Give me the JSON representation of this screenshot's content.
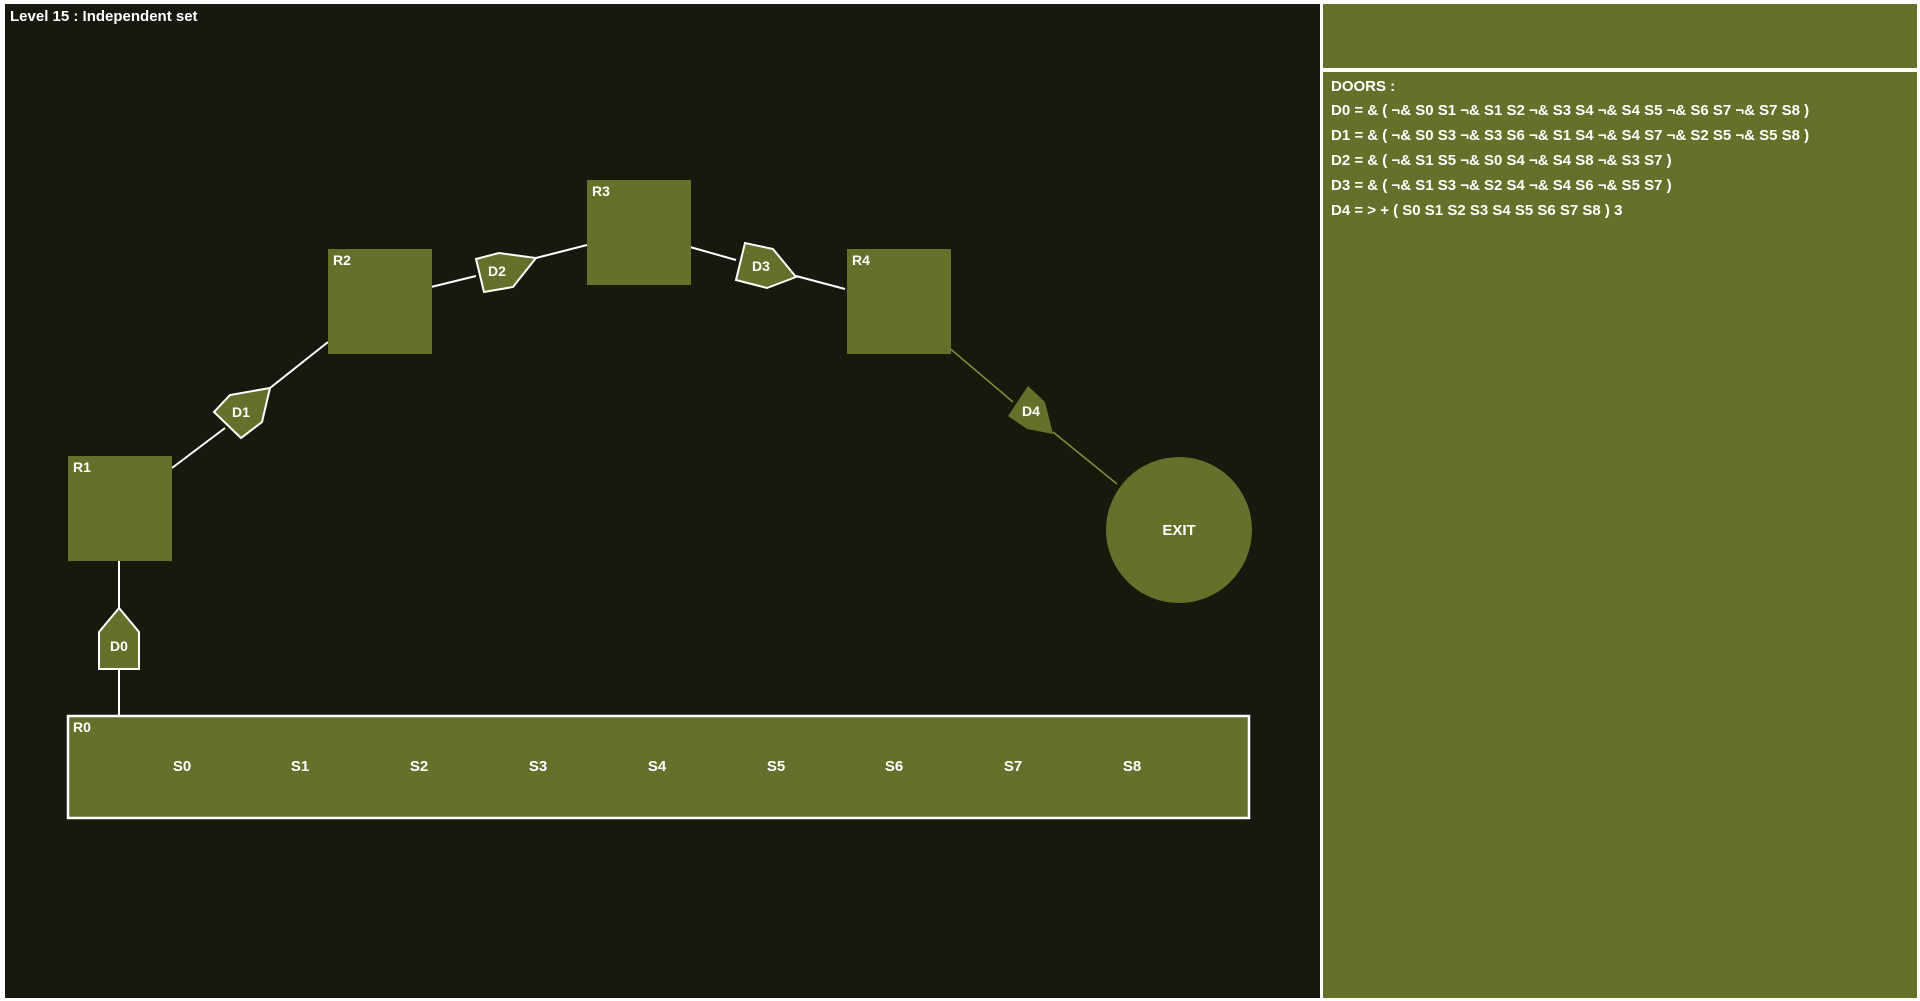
{
  "level_title": "Level 15 : Independent set",
  "colors": {
    "background": "#17190c",
    "room_fill": "#63712a",
    "panel_fill": "#63712a",
    "text": "#ffffff",
    "line": "#ffffff"
  },
  "map": {
    "rooms": [
      {
        "id": "r0",
        "label": "R0"
      },
      {
        "id": "r1",
        "label": "R1"
      },
      {
        "id": "r2",
        "label": "R2"
      },
      {
        "id": "r3",
        "label": "R3"
      },
      {
        "id": "r4",
        "label": "R4"
      }
    ],
    "doors": [
      {
        "id": "d0",
        "label": "D0"
      },
      {
        "id": "d1",
        "label": "D1"
      },
      {
        "id": "d2",
        "label": "D2"
      },
      {
        "id": "d3",
        "label": "D3"
      },
      {
        "id": "d4",
        "label": "D4"
      }
    ],
    "switches": [
      "S0",
      "S1",
      "S2",
      "S3",
      "S4",
      "S5",
      "S6",
      "S7",
      "S8"
    ],
    "exit_label": "EXIT"
  },
  "doors_panel": {
    "header": "DOORS :",
    "conditions": [
      "D0 = & ( ¬& S0 S1 ¬& S1 S2 ¬& S3 S4 ¬& S4 S5 ¬& S6 S7 ¬& S7 S8 )",
      "D1 = & ( ¬& S0 S3 ¬& S3 S6 ¬& S1 S4 ¬& S4 S7 ¬& S2 S5 ¬& S5 S8 )",
      "D2 = & ( ¬& S1 S5 ¬& S0 S4 ¬& S4 S8 ¬& S3 S7 )",
      "D3 = & ( ¬& S1 S3 ¬& S2 S4 ¬& S4 S6 ¬& S5 S7 )",
      "D4 = > + ( S0 S1 S2 S3 S4 S5 S6 S7 S8 )  3"
    ]
  }
}
